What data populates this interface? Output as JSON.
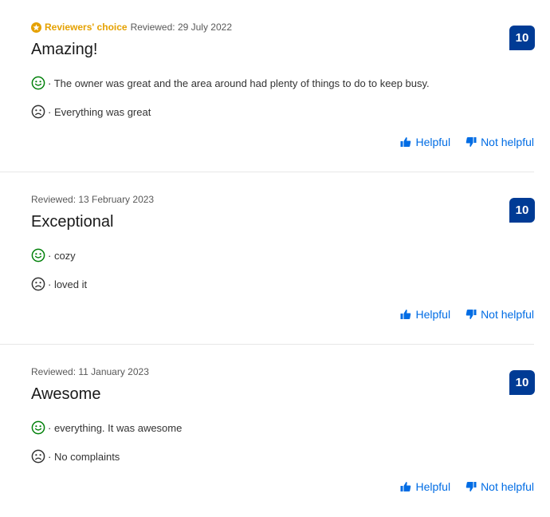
{
  "colors": {
    "accent": "#006ce4",
    "score_bg": "#003b95",
    "choice": "#e5a100",
    "positive": "#008009",
    "negative": "#333333"
  },
  "reviews": [
    {
      "badge": "Reviewers' choice",
      "date": "Reviewed: 29 July 2022",
      "title": "Amazing!",
      "score": "10",
      "liked": "· The owner was great and the area around had plenty of things to do to keep busy.",
      "disliked": "· Everything was great",
      "helpful": "Helpful",
      "not_helpful": "Not helpful"
    },
    {
      "date": "Reviewed: 13 February 2023",
      "title": "Exceptional",
      "score": "10",
      "liked": "· cozy",
      "disliked": "· loved it",
      "helpful": "Helpful",
      "not_helpful": "Not helpful"
    },
    {
      "date": "Reviewed: 11 January 2023",
      "title": "Awesome",
      "score": "10",
      "liked": "· everything. It was awesome",
      "disliked": "· No complaints",
      "helpful": "Helpful",
      "not_helpful": "Not helpful"
    }
  ]
}
